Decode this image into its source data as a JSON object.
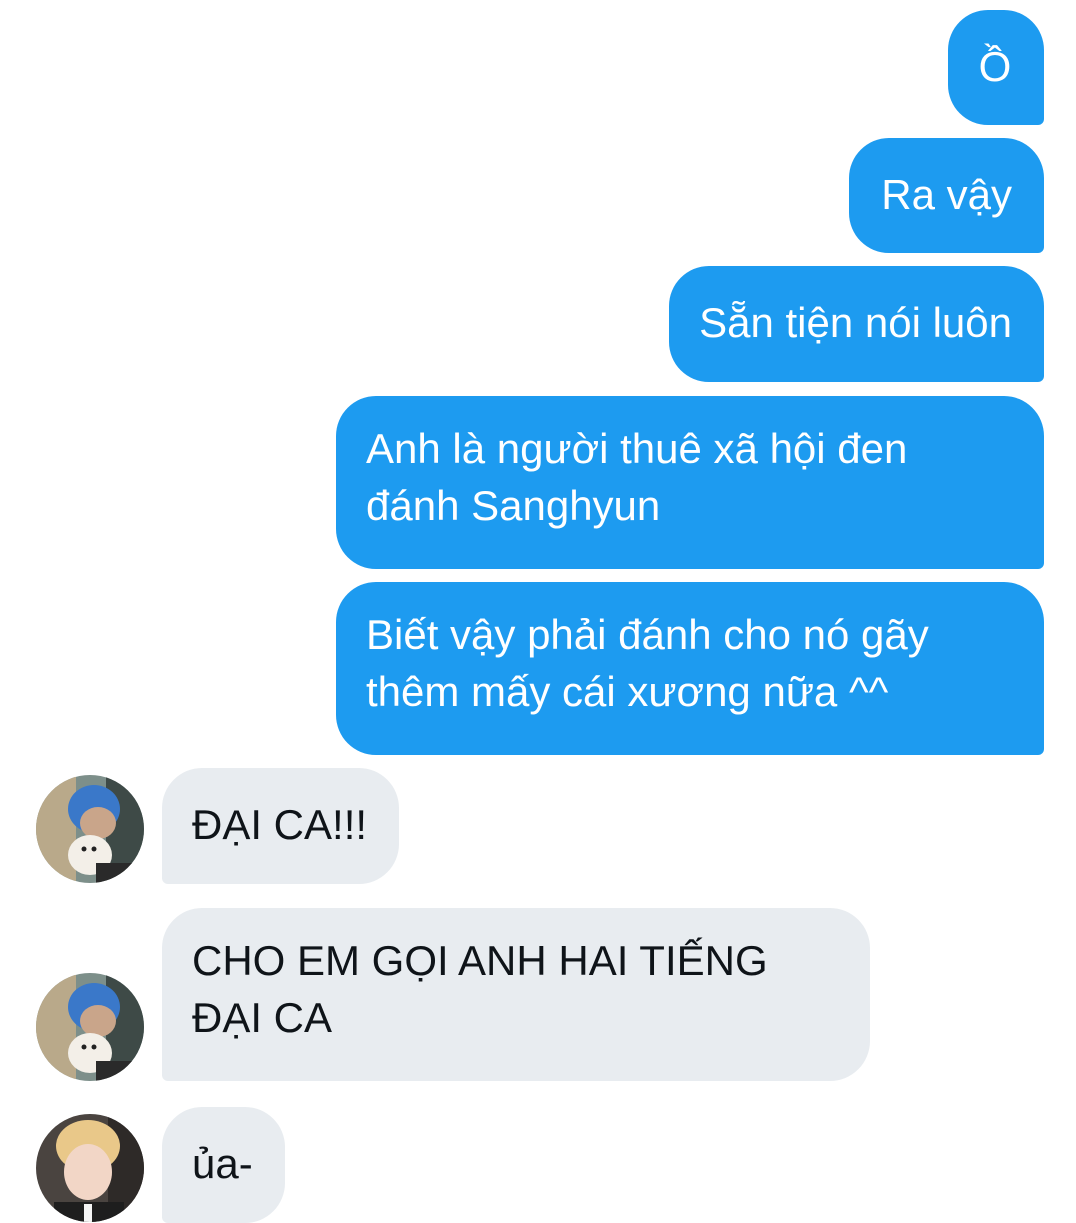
{
  "colors": {
    "outgoing_bubble": "#1d9bf0",
    "incoming_bubble": "#e8ecf0",
    "outgoing_text": "#ffffff",
    "incoming_text": "#0f1419"
  },
  "messages": [
    {
      "direction": "outgoing",
      "text": "Ồ"
    },
    {
      "direction": "outgoing",
      "text": "Ra vậy"
    },
    {
      "direction": "outgoing",
      "text": "Sẵn tiện nói luôn"
    },
    {
      "direction": "outgoing",
      "text": "Anh là người thuê xã hội đen\nđánh Sanghyun"
    },
    {
      "direction": "outgoing",
      "text": "Biết vậy phải đánh cho nó gãy\nthêm mấy cái xương nữa ^^"
    },
    {
      "direction": "incoming",
      "text": "ĐẠI CA!!!",
      "avatar": "avatar-blue-hair-with-dog"
    },
    {
      "direction": "incoming",
      "text": "CHO EM GỌI ANH HAI TIẾNG\nĐẠI CA",
      "avatar": "avatar-blue-hair-with-dog"
    },
    {
      "direction": "incoming",
      "text": "ủa-",
      "avatar": "avatar-blonde-hair"
    }
  ]
}
